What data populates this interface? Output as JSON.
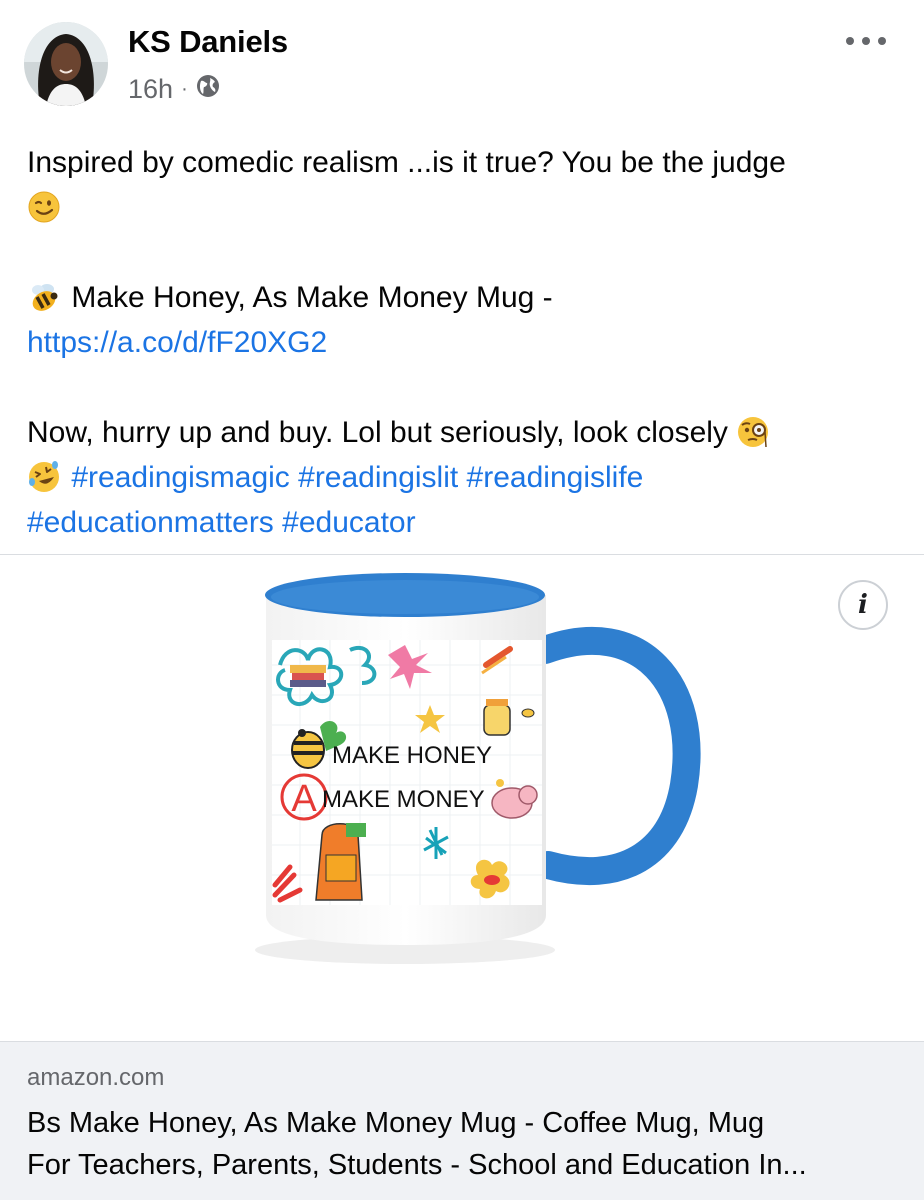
{
  "post": {
    "author": "KS Daniels",
    "time": "16h",
    "separator": "·",
    "audience_icon": "globe-icon",
    "more_icon": "ellipsis-icon",
    "line1": "Inspired by comedic realism ...is it true? You be the judge",
    "line1_emoji": "winking-face-emoji",
    "product_emoji": "bee-emoji",
    "product_text": " Make Honey, As Make Money Mug -",
    "product_link": "https://a.co/d/fF20XG2",
    "line3": "Now, hurry up and buy. Lol but seriously, look closely ",
    "line3_emoji1": "face-with-monocle-emoji",
    "line3_emoji2": "rolling-on-floor-laughing-emoji",
    "hashtags_line1": "#readingismagic #readingislit #readingislife",
    "hashtags_line2": "#educationmatters #educator"
  },
  "link_preview": {
    "image": {
      "text_line1": "MAKE HONEY",
      "text_line2": "MAKE MONEY",
      "grade_letter": "A",
      "mug_color": "#2f7fcf",
      "info_icon": "info-icon",
      "info_label": "i"
    },
    "domain": "amazon.com",
    "title_line1": "Bs Make Honey, As Make Money Mug - Coffee Mug, Mug",
    "title_line2": "For Teachers, Parents, Students - School and Education In..."
  }
}
